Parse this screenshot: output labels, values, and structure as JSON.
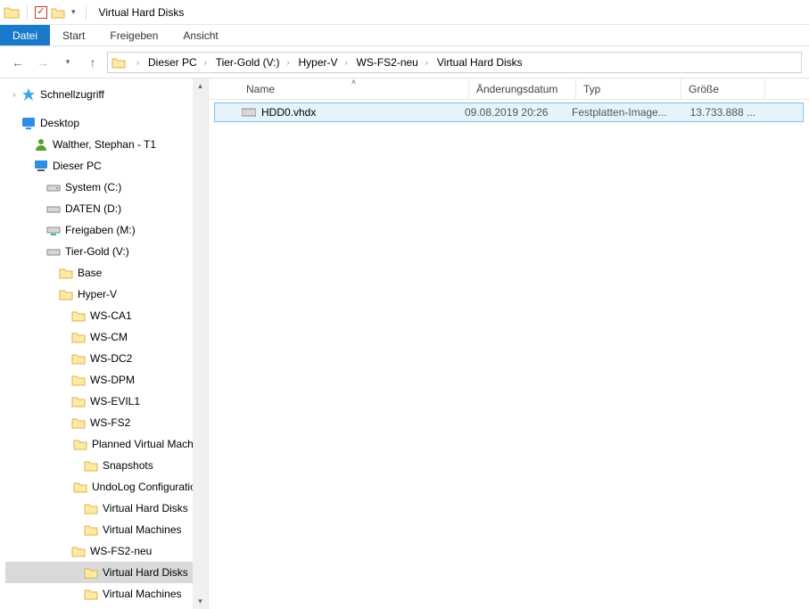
{
  "titlebar": {
    "title": "Virtual Hard Disks"
  },
  "ribbon": {
    "file": "Datei",
    "home": "Start",
    "share": "Freigeben",
    "view": "Ansicht"
  },
  "breadcrumb": {
    "items": [
      "Dieser PC",
      "Tier-Gold (V:)",
      "Hyper-V",
      "WS-FS2-neu",
      "Virtual Hard Disks"
    ]
  },
  "columns": {
    "name": "Name",
    "date": "Änderungsdatum",
    "type": "Typ",
    "size": "Größe"
  },
  "file": {
    "name": "HDD0.vhdx",
    "date": "09.08.2019 20:26",
    "type": "Festplatten-Image...",
    "size": "13.733.888 ..."
  },
  "tree": {
    "quickaccess": "Schnellzugriff",
    "desktop": "Desktop",
    "user": "Walther, Stephan - T1",
    "thispc": "Dieser PC",
    "systemc": "System (C:)",
    "datend": "DATEN (D:)",
    "freigaben": "Freigaben (M:)",
    "tiergold": "Tier-Gold (V:)",
    "base": "Base",
    "hyperv": "Hyper-V",
    "wsca1": "WS-CA1",
    "wscm": "WS-CM",
    "wsdc2": "WS-DC2",
    "wsdpm": "WS-DPM",
    "wsevil1": "WS-EVIL1",
    "wsfs2": "WS-FS2",
    "planned": "Planned Virtual Machines",
    "snapshots": "Snapshots",
    "undolog": "UndoLog Configuration",
    "vhd": "Virtual Hard Disks",
    "vm": "Virtual Machines",
    "wsfs2neu": "WS-FS2-neu",
    "vhd2": "Virtual Hard Disks",
    "vm2": "Virtual Machines"
  }
}
